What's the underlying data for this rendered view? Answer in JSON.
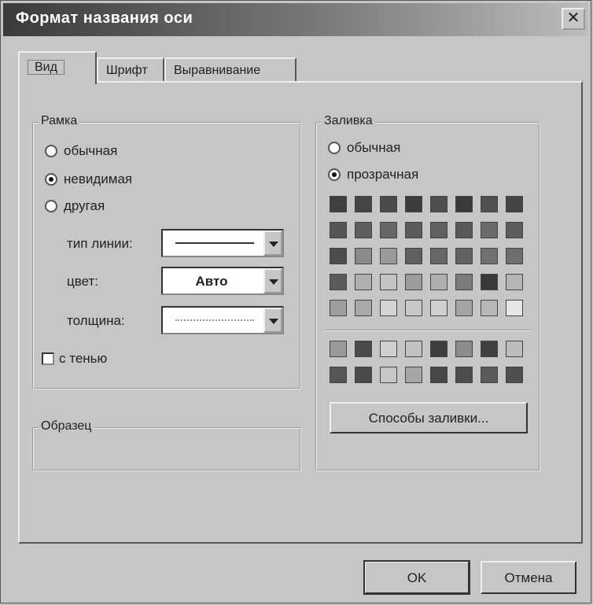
{
  "dialog": {
    "title": "Формат названия оси",
    "close_glyph": "✕"
  },
  "tabs": [
    "Вид",
    "Шрифт",
    "Выравнивание"
  ],
  "frame_group": {
    "legend": "Рамка",
    "options": [
      "обычная",
      "невидимая",
      "другая"
    ],
    "selected": "невидимая",
    "line_type_label": "тип линии:",
    "color_label": "цвет:",
    "color_value": "Авто",
    "thickness_label": "толщина:",
    "shadow_label": "с тенью"
  },
  "fill_group": {
    "legend": "Заливка",
    "options": [
      "обычная",
      "прозрачная"
    ],
    "selected": "прозрачная",
    "palette_top": [
      [
        "#3f3f3f",
        "#454545",
        "#4a4a4a",
        "#3c3c3c",
        "#4e4e4e",
        "#3a3a3a",
        "#505050",
        "#444444"
      ],
      [
        "#555555",
        "#5e5e5e",
        "#666666",
        "#5a5a5a",
        "#606060",
        "#585858",
        "#6a6a6a",
        "#5c5c5c"
      ],
      [
        "#4c4c4c",
        "#8a8a8a",
        "#9a9a9a",
        "#5f5f5f",
        "#676767",
        "#626262",
        "#707070",
        "#6e6e6e"
      ],
      [
        "#5a5a5a",
        "#b0b0b0",
        "#c4c4c4",
        "#9c9c9c",
        "#aeaeae",
        "#7c7c7c",
        "#3a3a3a",
        "#b4b4b4"
      ],
      [
        "#9e9e9e",
        "#a8a8a8",
        "#d4d4d4",
        "#c8c8c8",
        "#cfcfcf",
        "#a4a4a4",
        "#b8b8b8",
        "#e6e6e6"
      ]
    ],
    "palette_bottom": [
      [
        "#9a9a9a",
        "#4a4a4a",
        "#d0d0d0",
        "#c2c2c2",
        "#3e3e3e",
        "#8c8c8c",
        "#404040",
        "#bcbcbc"
      ],
      [
        "#555555",
        "#4a4a4a",
        "#c6c6c6",
        "#a6a6a6",
        "#474747",
        "#4c4c4c",
        "#5a5a5a",
        "#4f4f4f"
      ]
    ],
    "fill_effects_label": "Способы заливки..."
  },
  "sample_group": {
    "legend": "Образец"
  },
  "buttons": {
    "ok": "OK",
    "cancel": "Отмена"
  }
}
